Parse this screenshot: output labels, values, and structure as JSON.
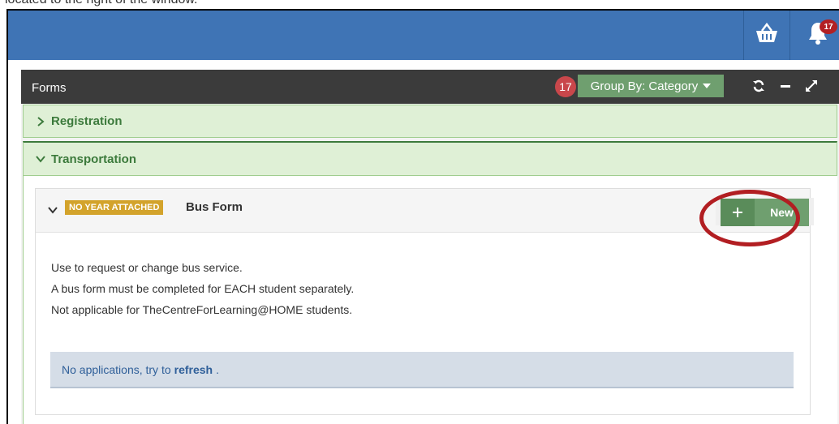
{
  "caption": "located to the right of the window.",
  "topbar": {
    "basket_icon": "basket-icon",
    "bell_icon": "bell-icon",
    "notification_count": "17"
  },
  "panel": {
    "title": "Forms",
    "count": "17",
    "group_by_label": "Group By: Category",
    "refresh_icon": "refresh-icon",
    "minimize_icon": "minimize-icon",
    "expand_icon": "expand-icon"
  },
  "categories": [
    {
      "label": "Registration",
      "expanded": false
    },
    {
      "label": "Transportation",
      "expanded": true
    }
  ],
  "form": {
    "year_tag": "NO YEAR ATTACHED",
    "name": "Bus Form",
    "new_label": "New",
    "description": [
      "Use to request or change bus service.",
      "A bus form must be completed for EACH student separately.",
      "Not applicable for TheCentreForLearning@HOME students."
    ],
    "empty_text": "No applications, try to",
    "refresh_link": "refresh",
    "empty_suffix": "."
  },
  "colors": {
    "topbar": "#3f74b5",
    "panel_header": "#3b3b3b",
    "category_bg": "#dff0d6",
    "accent_green": "#6f9f6f",
    "year_tag": "#d3a32b",
    "highlight": "#b21e22"
  }
}
